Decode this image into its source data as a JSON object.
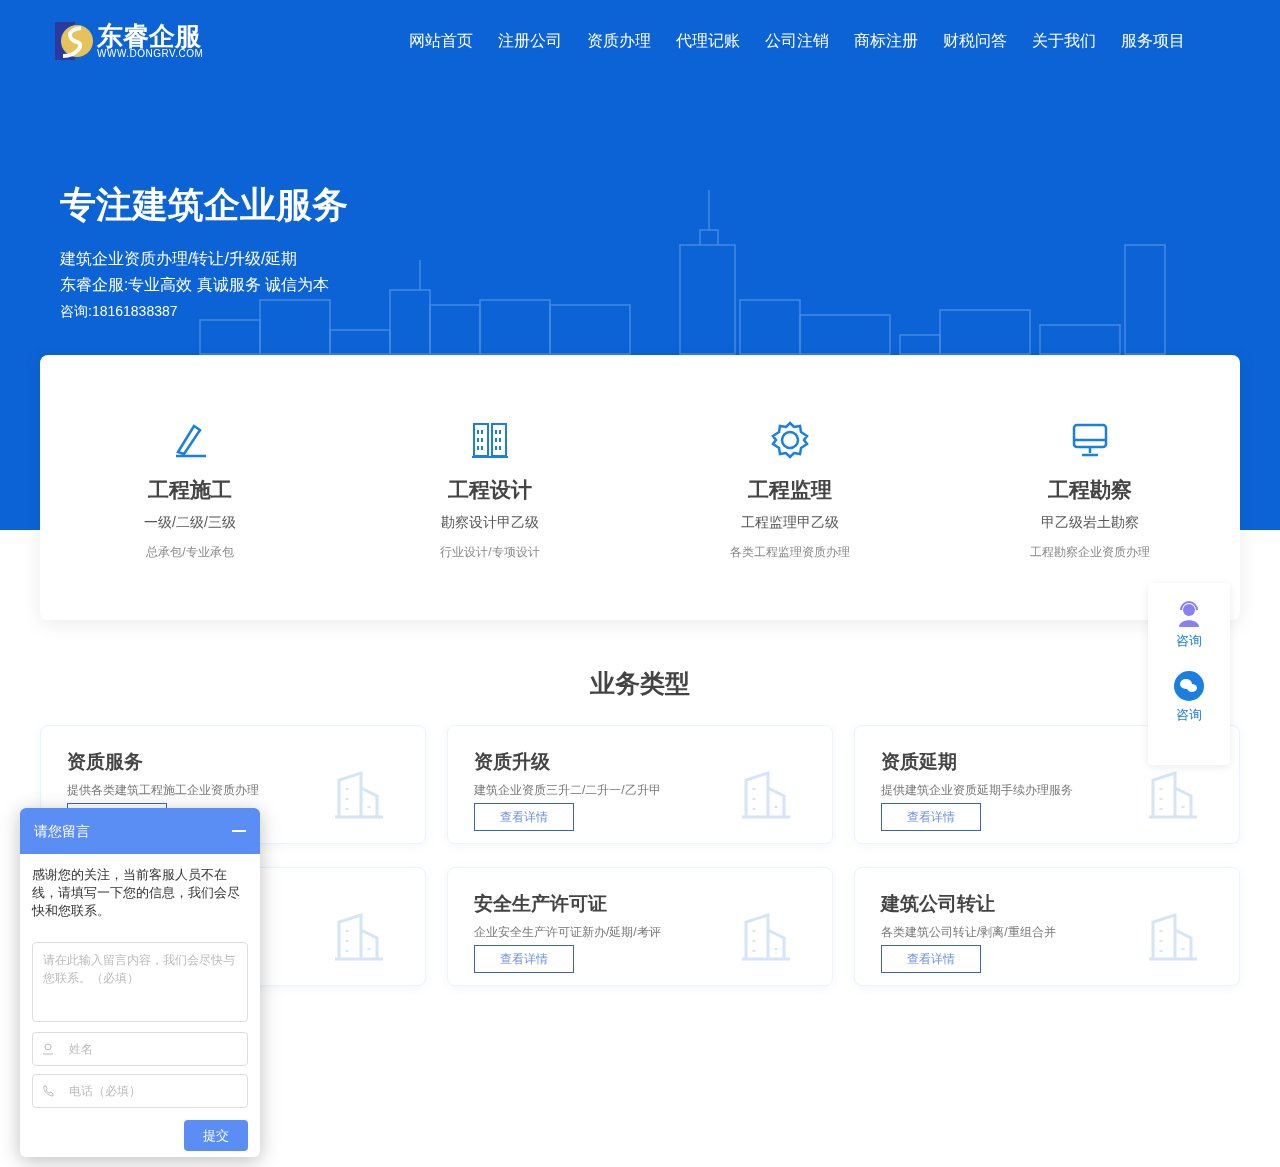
{
  "header": {
    "logo_name": "东睿企服",
    "logo_url": "WWW.DONGRV.COM",
    "nav": [
      {
        "label": "网站首页"
      },
      {
        "label": "注册公司"
      },
      {
        "label": "资质办理"
      },
      {
        "label": "代理记账"
      },
      {
        "label": "公司注销"
      },
      {
        "label": "商标注册"
      },
      {
        "label": "财税问答"
      },
      {
        "label": "关于我们"
      },
      {
        "label": "服务项目"
      }
    ]
  },
  "hero": {
    "title": "专注建筑企业服务",
    "lines": [
      "建筑企业资质办理/转让/升级/延期",
      "东睿企服:专业高效 真诚服务 诚信为本"
    ],
    "contact": "咨询:18161838387"
  },
  "features": [
    {
      "kind": "pen",
      "title": "工程施工",
      "subtitle": "一级/二级/三级",
      "note": "总承包/专业承包"
    },
    {
      "kind": "buildings",
      "title": "工程设计",
      "subtitle": "勘察设计甲乙级",
      "note": "行业设计/专项设计"
    },
    {
      "kind": "gear",
      "title": "工程监理",
      "subtitle": "工程监理甲乙级",
      "note": "各类工程监理资质办理"
    },
    {
      "kind": "monitor",
      "title": "工程勘察",
      "subtitle": "甲乙级岩土勘察",
      "note": "工程勘察企业资质办理"
    }
  ],
  "business": {
    "title": "业务类型",
    "cards": [
      {
        "kind": "service",
        "title": "资质服务",
        "desc": "提供各类建筑工程施工企业资质办理",
        "button_covered": true
      },
      {
        "kind": "service",
        "title": "资质升级",
        "desc": "建筑企业资质三升二/二升一/乙升甲",
        "button": "查看详情"
      },
      {
        "kind": "service",
        "title": "资质延期",
        "desc": "提供建筑企业资质延期手续办理服务",
        "button": "查看详情"
      },
      {
        "kind": "covered"
      },
      {
        "kind": "service",
        "title": "安全生产许可证",
        "desc": "企业安全生产许可证新办/延期/考评",
        "button": "查看详情"
      },
      {
        "kind": "service",
        "title": "建筑公司转让",
        "desc": "各类建筑公司转让/剥离/重组合并",
        "button": "查看详情"
      }
    ]
  },
  "float_bar": [
    {
      "kind": "agent",
      "label": "咨询"
    },
    {
      "kind": "wechat",
      "label": "咨询"
    }
  ],
  "chat": {
    "title": "请您留言",
    "intro": "感谢您的关注，当前客服人员不在线，请填写一下您的信息，我们会尽快和您联系。",
    "message_placeholder": "请在此输入留言内容，我们会尽快与您联系。（必填）",
    "name_placeholder": "姓名",
    "phone_placeholder": "电话（必填）",
    "submit": "提交"
  }
}
